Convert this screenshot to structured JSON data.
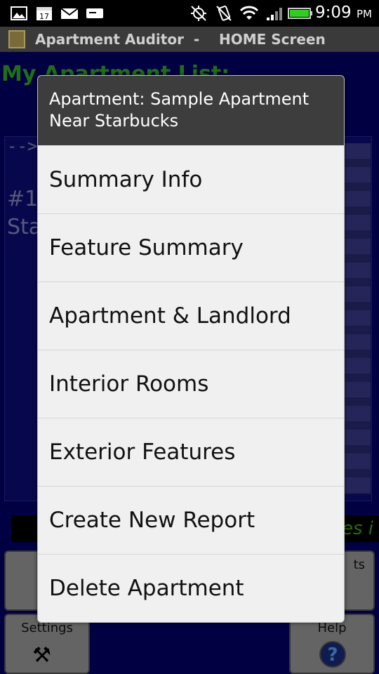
{
  "status_bar": {
    "time": "9:09",
    "ampm": "PM",
    "icons": [
      "gallery-icon",
      "calendar-icon",
      "mail-icon",
      "messages-icon",
      "gps-icon",
      "vibrate-icon",
      "wifi-icon",
      "signal-icon",
      "battery-icon"
    ]
  },
  "title_bar": {
    "title": "Apartment Auditor  -    HOME Screen"
  },
  "background": {
    "heading": "My Apartment List:",
    "arrow": "-->",
    "item_number": "#1",
    "item_name_partial": "Sta",
    "strip_text": "es i",
    "buttons": {
      "settings": "Settings",
      "help": "Help",
      "top_left_partial": "S",
      "top_right_partial": "ts"
    }
  },
  "dialog": {
    "header": "Apartment: Sample Apartment Near Starbucks",
    "items": [
      "Summary Info",
      "Feature Summary",
      "Apartment & Landlord",
      "Interior Rooms",
      "Exterior Features",
      "Create New Report",
      "Delete Apartment"
    ]
  },
  "colors": {
    "app_background": "#000066",
    "heading_green": "#33aa22",
    "dialog_header": "#3d3d3d",
    "dialog_body": "#f0f0f0"
  }
}
